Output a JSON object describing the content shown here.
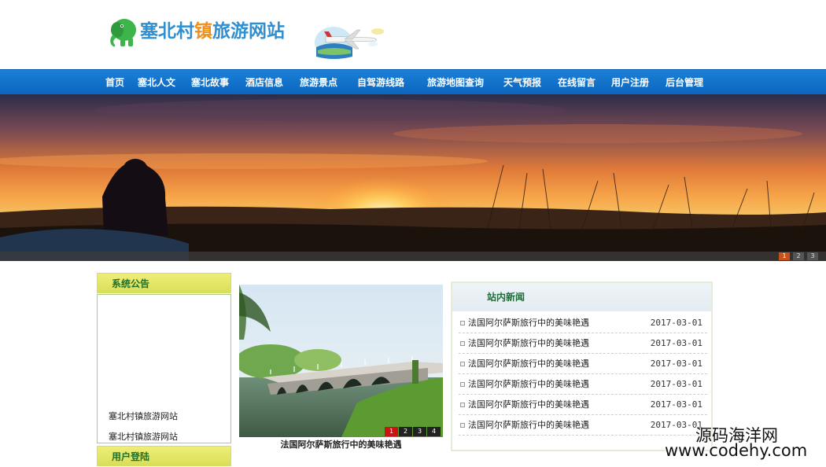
{
  "site": {
    "title_part1": "塞北村",
    "title_part2": "镇",
    "title_part3": "旅游网站"
  },
  "nav": {
    "items": [
      {
        "label": "首页"
      },
      {
        "label": "塞北人文"
      },
      {
        "label": "塞北故事"
      },
      {
        "label": "酒店信息"
      },
      {
        "label": "旅游景点"
      },
      {
        "label": "自驾游线路"
      },
      {
        "label": "旅游地图查询"
      },
      {
        "label": "天气预报"
      },
      {
        "label": "在线留言"
      },
      {
        "label": "用户注册"
      },
      {
        "label": "后台管理"
      }
    ]
  },
  "banner": {
    "pages": [
      "1",
      "2",
      "3"
    ],
    "active": "1"
  },
  "sidebar": {
    "notice_title": "系统公告",
    "notices": [
      "塞北村镇旅游网站",
      "塞北村镇旅游网站"
    ],
    "login_title": "用户登陆"
  },
  "slideshow": {
    "caption": "法国阿尔萨斯旅行中的美味艳遇",
    "pages": [
      "1",
      "2",
      "3",
      "4"
    ],
    "active": "1"
  },
  "news": {
    "title": "站内新闻",
    "items": [
      {
        "title": "法国阿尔萨斯旅行中的美味艳遇",
        "date": "2017-03-01"
      },
      {
        "title": "法国阿尔萨斯旅行中的美味艳遇",
        "date": "2017-03-01"
      },
      {
        "title": "法国阿尔萨斯旅行中的美味艳遇",
        "date": "2017-03-01"
      },
      {
        "title": "法国阿尔萨斯旅行中的美味艳遇",
        "date": "2017-03-01"
      },
      {
        "title": "法国阿尔萨斯旅行中的美味艳遇",
        "date": "2017-03-01"
      },
      {
        "title": "法国阿尔萨斯旅行中的美味艳遇",
        "date": "2017-03-01"
      }
    ]
  },
  "watermark": {
    "line1": "源码海洋网",
    "line2": "www.codehy.com"
  },
  "colors": {
    "nav_bg": "#0b66bf",
    "panel_title_bg": "#dfe35e",
    "panel_title_text": "#21702a",
    "active_page": "#c8501a"
  }
}
